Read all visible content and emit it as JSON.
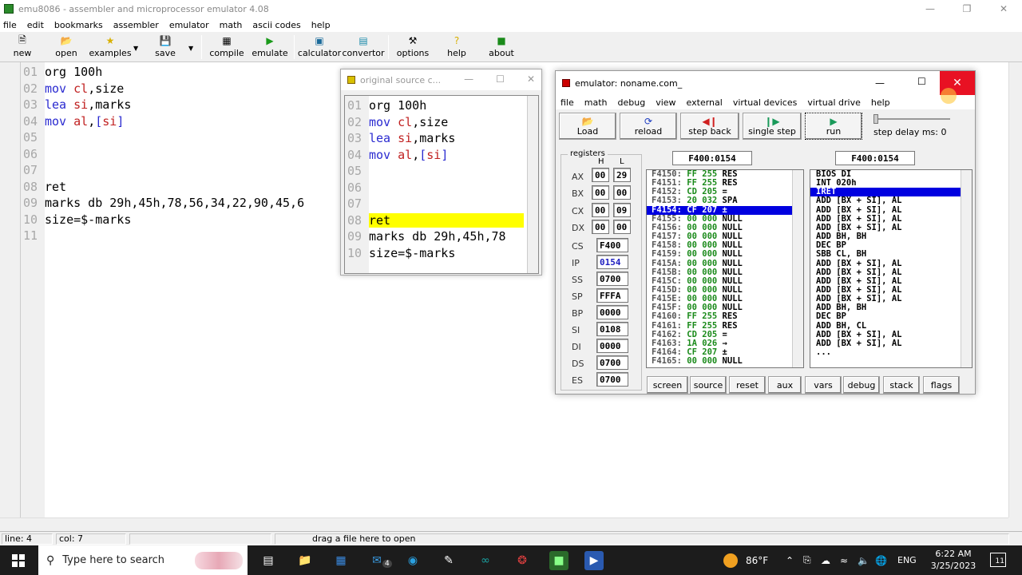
{
  "main": {
    "title": "emu8086 - assembler and microprocessor emulator 4.08",
    "menu": [
      "file",
      "edit",
      "bookmarks",
      "assembler",
      "emulator",
      "math",
      "ascii codes",
      "help"
    ],
    "toolbar": {
      "new": "new",
      "open": "open",
      "examples": "examples",
      "save": "save",
      "compile": "compile",
      "emulate": "emulate",
      "calculator": "calculator",
      "convertor": "convertor",
      "options": "options",
      "help": "help",
      "about": "about"
    },
    "code": [
      {
        "n": "01",
        "t": "org 100h"
      },
      {
        "n": "02",
        "t": "mov cl,size"
      },
      {
        "n": "03",
        "t": "lea si,marks"
      },
      {
        "n": "04",
        "t": "mov al,[si]"
      },
      {
        "n": "05",
        "t": ""
      },
      {
        "n": "06",
        "t": ""
      },
      {
        "n": "07",
        "t": ""
      },
      {
        "n": "08",
        "t": "ret"
      },
      {
        "n": "09",
        "t": "marks db 29h,45h,78,56,34,22,90,45,6"
      },
      {
        "n": "10",
        "t": "size=$-marks"
      },
      {
        "n": "11",
        "t": ""
      }
    ],
    "status": {
      "line": "line: 4",
      "col": "col: 7",
      "hint": "drag a file here to open"
    }
  },
  "source_window": {
    "title": "original source c...",
    "lines": [
      {
        "n": "01",
        "t": "org 100h"
      },
      {
        "n": "02",
        "t": "mov cl,size"
      },
      {
        "n": "03",
        "t": "lea si,marks"
      },
      {
        "n": "04",
        "t": "mov al,[si]"
      },
      {
        "n": "05",
        "t": ""
      },
      {
        "n": "06",
        "t": ""
      },
      {
        "n": "07",
        "t": ""
      },
      {
        "n": "08",
        "t": "ret"
      },
      {
        "n": "09",
        "t": "marks db 29h,45h,78"
      },
      {
        "n": "10",
        "t": "size=$-marks"
      }
    ],
    "highlight_line": "08",
    "highlight_color": "#ffff00"
  },
  "emulator": {
    "title": "emulator: noname.com_",
    "menu": [
      "file",
      "math",
      "debug",
      "view",
      "external",
      "virtual devices",
      "virtual drive",
      "help"
    ],
    "buttons": {
      "load": "Load",
      "reload": "reload",
      "step_back": "step back",
      "single_step": "single step",
      "run": "run"
    },
    "step_delay": "step delay ms: 0",
    "registers_label": "registers",
    "hl": {
      "h": "H",
      "l": "L"
    },
    "regs_hl": [
      {
        "name": "AX",
        "h": "00",
        "l": "29"
      },
      {
        "name": "BX",
        "h": "00",
        "l": "00"
      },
      {
        "name": "CX",
        "h": "00",
        "l": "09"
      },
      {
        "name": "DX",
        "h": "00",
        "l": "00"
      }
    ],
    "regs": [
      {
        "name": "CS",
        "v": "F400"
      },
      {
        "name": "IP",
        "v": "0154"
      },
      {
        "name": "SS",
        "v": "0700"
      },
      {
        "name": "SP",
        "v": "FFFA"
      },
      {
        "name": "BP",
        "v": "0000"
      },
      {
        "name": "SI",
        "v": "0108"
      },
      {
        "name": "DI",
        "v": "0000"
      },
      {
        "name": "DS",
        "v": "0700"
      },
      {
        "name": "ES",
        "v": "0700"
      }
    ],
    "addr_left": "F400:0154",
    "addr_right": "F400:0154",
    "memory": [
      {
        "a": "F4150:",
        "h": "FF",
        "d": "255",
        "c": "RES"
      },
      {
        "a": "F4151:",
        "h": "FF",
        "d": "255",
        "c": "RES"
      },
      {
        "a": "F4152:",
        "h": "CD",
        "d": "205",
        "c": "="
      },
      {
        "a": "F4153:",
        "h": "20",
        "d": "032",
        "c": "SPA"
      },
      {
        "a": "F4154:",
        "h": "CF",
        "d": "207",
        "c": "±"
      },
      {
        "a": "F4155:",
        "h": "00",
        "d": "000",
        "c": "NULL"
      },
      {
        "a": "F4156:",
        "h": "00",
        "d": "000",
        "c": "NULL"
      },
      {
        "a": "F4157:",
        "h": "00",
        "d": "000",
        "c": "NULL"
      },
      {
        "a": "F4158:",
        "h": "00",
        "d": "000",
        "c": "NULL"
      },
      {
        "a": "F4159:",
        "h": "00",
        "d": "000",
        "c": "NULL"
      },
      {
        "a": "F415A:",
        "h": "00",
        "d": "000",
        "c": "NULL"
      },
      {
        "a": "F415B:",
        "h": "00",
        "d": "000",
        "c": "NULL"
      },
      {
        "a": "F415C:",
        "h": "00",
        "d": "000",
        "c": "NULL"
      },
      {
        "a": "F415D:",
        "h": "00",
        "d": "000",
        "c": "NULL"
      },
      {
        "a": "F415E:",
        "h": "00",
        "d": "000",
        "c": "NULL"
      },
      {
        "a": "F415F:",
        "h": "00",
        "d": "000",
        "c": "NULL"
      },
      {
        "a": "F4160:",
        "h": "FF",
        "d": "255",
        "c": "RES"
      },
      {
        "a": "F4161:",
        "h": "FF",
        "d": "255",
        "c": "RES"
      },
      {
        "a": "F4162:",
        "h": "CD",
        "d": "205",
        "c": "="
      },
      {
        "a": "F4163:",
        "h": "1A",
        "d": "026",
        "c": "→"
      },
      {
        "a": "F4164:",
        "h": "CF",
        "d": "207",
        "c": "±"
      },
      {
        "a": "F4165:",
        "h": "00",
        "d": "000",
        "c": "NULL"
      }
    ],
    "memory_selected": 4,
    "disasm": [
      "BIOS DI",
      "INT 020h",
      "IRET",
      "ADD [BX + SI], AL",
      "ADD [BX + SI], AL",
      "ADD [BX + SI], AL",
      "ADD [BX + SI], AL",
      "ADD BH, BH",
      "DEC BP",
      "SBB CL, BH",
      "ADD [BX + SI], AL",
      "ADD [BX + SI], AL",
      "ADD [BX + SI], AL",
      "ADD [BX + SI], AL",
      "ADD [BX + SI], AL",
      "ADD BH, BH",
      "DEC BP",
      "ADD BH, CL",
      "ADD [BX + SI], AL",
      "ADD [BX + SI], AL",
      "..."
    ],
    "disasm_selected": 2,
    "bottom": [
      "screen",
      "source",
      "reset",
      "aux",
      "vars",
      "debug",
      "stack",
      "flags"
    ]
  },
  "taskbar": {
    "search_placeholder": "Type here to search",
    "mail_badge": "4",
    "temp": "86°F",
    "lang": "ENG",
    "time": "6:22 AM",
    "date": "3/25/2023",
    "notif_count": "11"
  }
}
